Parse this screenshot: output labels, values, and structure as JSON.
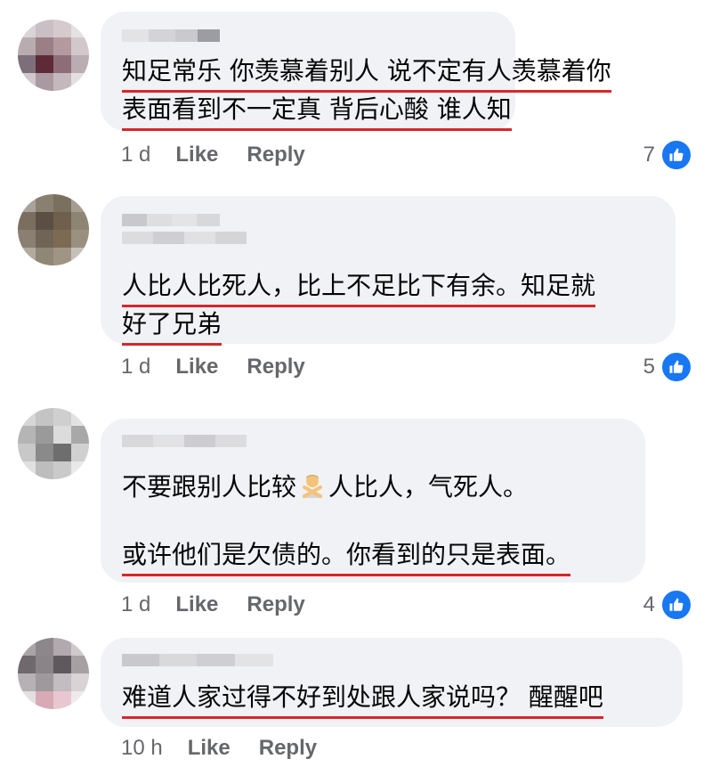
{
  "comments": [
    {
      "lines": [
        "知足常乐 你羡慕着别人 说不定有人羡慕着你",
        "表面看到不一定真 背后心酸 谁人知"
      ],
      "age": "1 d",
      "like": "Like",
      "reply": "Reply",
      "reactions": "7"
    },
    {
      "lines": [
        "人比人比死人，比上不足比下有余。知足就",
        "好了兄弟"
      ],
      "age": "1 d",
      "like": "Like",
      "reply": "Reply",
      "reactions": "5"
    },
    {
      "line1_a": "不要跟别人比较",
      "line1_b": "人比人，气死人。",
      "line2": "或许他们是欠债的。你看到的只是表面。",
      "emoji": "person-gesturing-no-icon",
      "age": "1 d",
      "like": "Like",
      "reply": "Reply",
      "reactions": "4"
    },
    {
      "lines": [
        "难道人家过得不好到处跟人家说吗？ 醒醒吧"
      ],
      "age": "10 h",
      "like": "Like",
      "reply": "Reply"
    }
  ],
  "colors": {
    "bubble": "#f0f2f5",
    "underline": "#d8262c",
    "like_blue": "#1877f2",
    "meta": "#65676b"
  }
}
